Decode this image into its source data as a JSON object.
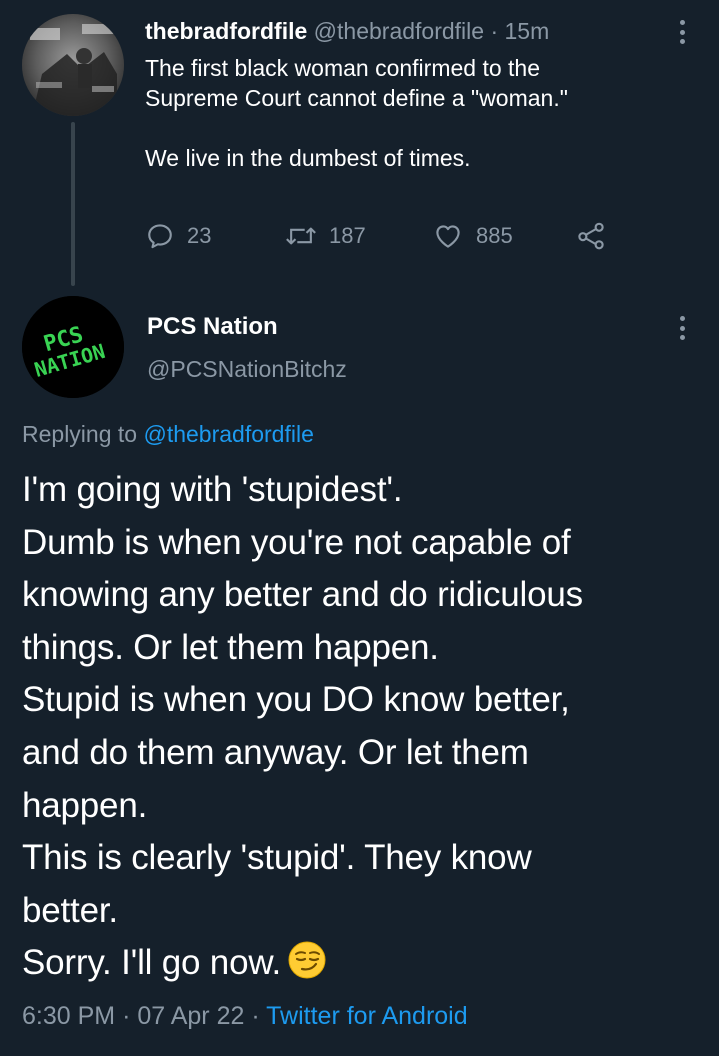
{
  "parent_tweet": {
    "display_name": "thebradfordfile",
    "handle": "@thebradfordfile",
    "separator": "·",
    "time_ago": "15m",
    "text_lines": [
      "The first black woman confirmed to the",
      "Supreme Court cannot define a \"woman.\"",
      "",
      "We live in the dumbest of times."
    ],
    "actions": {
      "reply_count": "23",
      "retweet_count": "187",
      "like_count": "885"
    }
  },
  "reply_tweet": {
    "display_name": "PCS Nation",
    "handle": "@PCSNationBitchz",
    "avatar_text": [
      "PCS",
      "NATION"
    ],
    "replying_prefix": "Replying to",
    "replying_to": "@thebradfordfile",
    "body_lines": [
      "I'm going with 'stupidest'.",
      "Dumb is when you're not capable of",
      "knowing any better and do ridiculous",
      "things. Or let them happen.",
      "Stupid is when you DO know better,",
      "and do them anyway. Or let them",
      "happen.",
      "This is clearly 'stupid'. They know",
      "better.",
      "Sorry. I'll go now."
    ],
    "emoji": "smirking-face",
    "time": "6:30 PM",
    "sep1": "·",
    "date": "07 Apr 22",
    "sep2": "·",
    "source": "Twitter for Android"
  },
  "colors": {
    "background": "#15202b",
    "secondary_text": "#8b98a5",
    "link": "#1d9bf0",
    "avatar_text_green": "#39d353"
  }
}
